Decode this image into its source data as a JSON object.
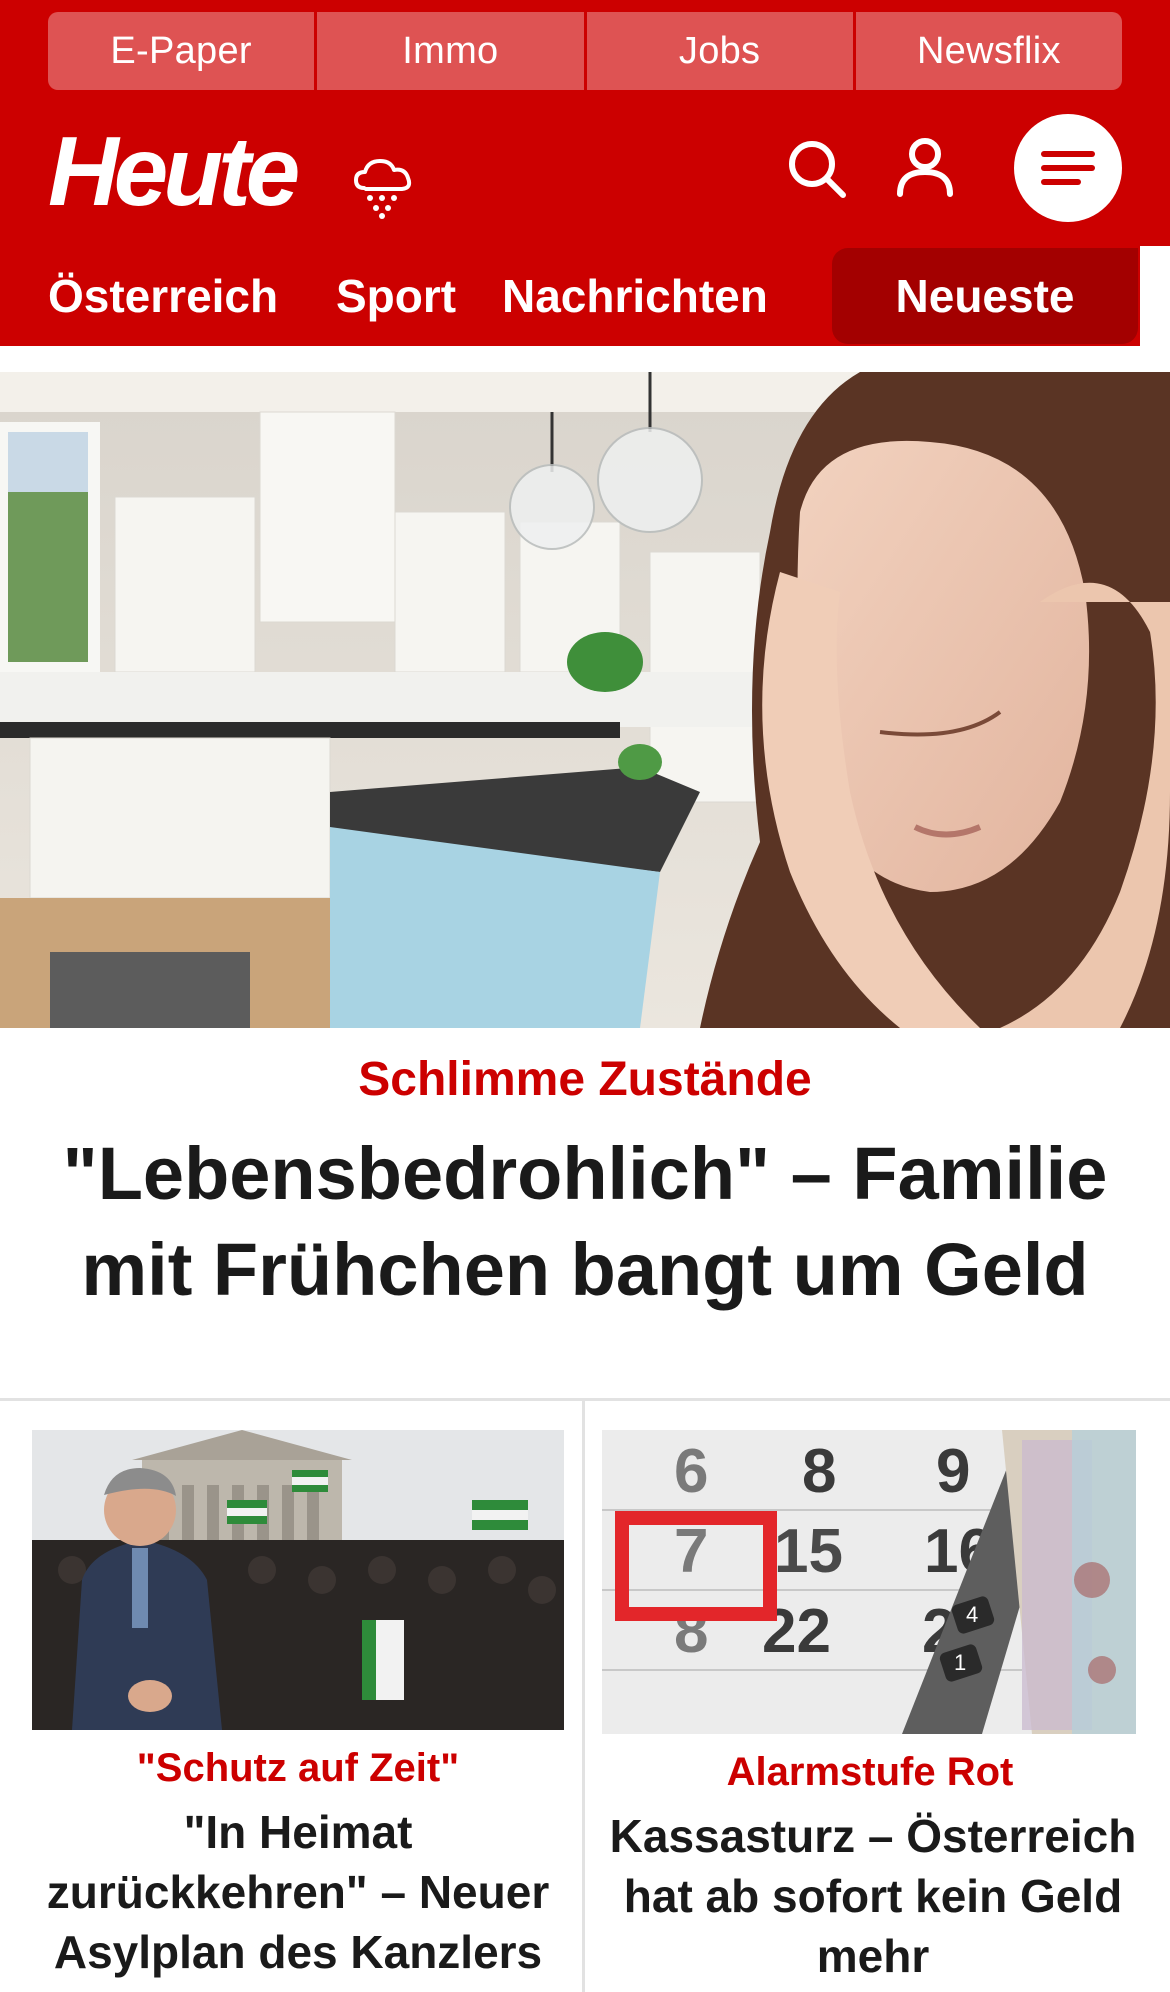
{
  "header": {
    "top_links": [
      "E-Paper",
      "Immo",
      "Jobs",
      "Newsflix"
    ],
    "logo_text": "Heute",
    "weather_icon": "rain-cloud-icon",
    "search_icon": "search-icon",
    "user_icon": "user-icon",
    "menu_icon": "hamburger-menu-icon",
    "brand_color": "#cc0000"
  },
  "section_nav": {
    "items": [
      "Österreich",
      "Sport",
      "Nachrichten"
    ],
    "active": "Neueste"
  },
  "hero": {
    "kicker": "Schlimme Zustände",
    "title": "\"Lebensbedrohlich\" – Familie mit Frühchen bangt um Geld"
  },
  "teasers": [
    {
      "kicker": "\"Schutz auf Zeit\"",
      "title": "\"In Heimat zurückkehren\" – Neuer Asylplan des Kanzlers"
    },
    {
      "kicker": "Alarmstufe Rot",
      "title": "Kassasturz – Österreich hat ab sofort kein Geld mehr"
    }
  ],
  "calendar_numbers": {
    "row1": [
      "6",
      "8",
      "9"
    ],
    "row2": [
      "7",
      "15",
      "16"
    ],
    "row3": [
      "8",
      "22",
      "2"
    ],
    "keys": [
      "4",
      "1"
    ]
  }
}
